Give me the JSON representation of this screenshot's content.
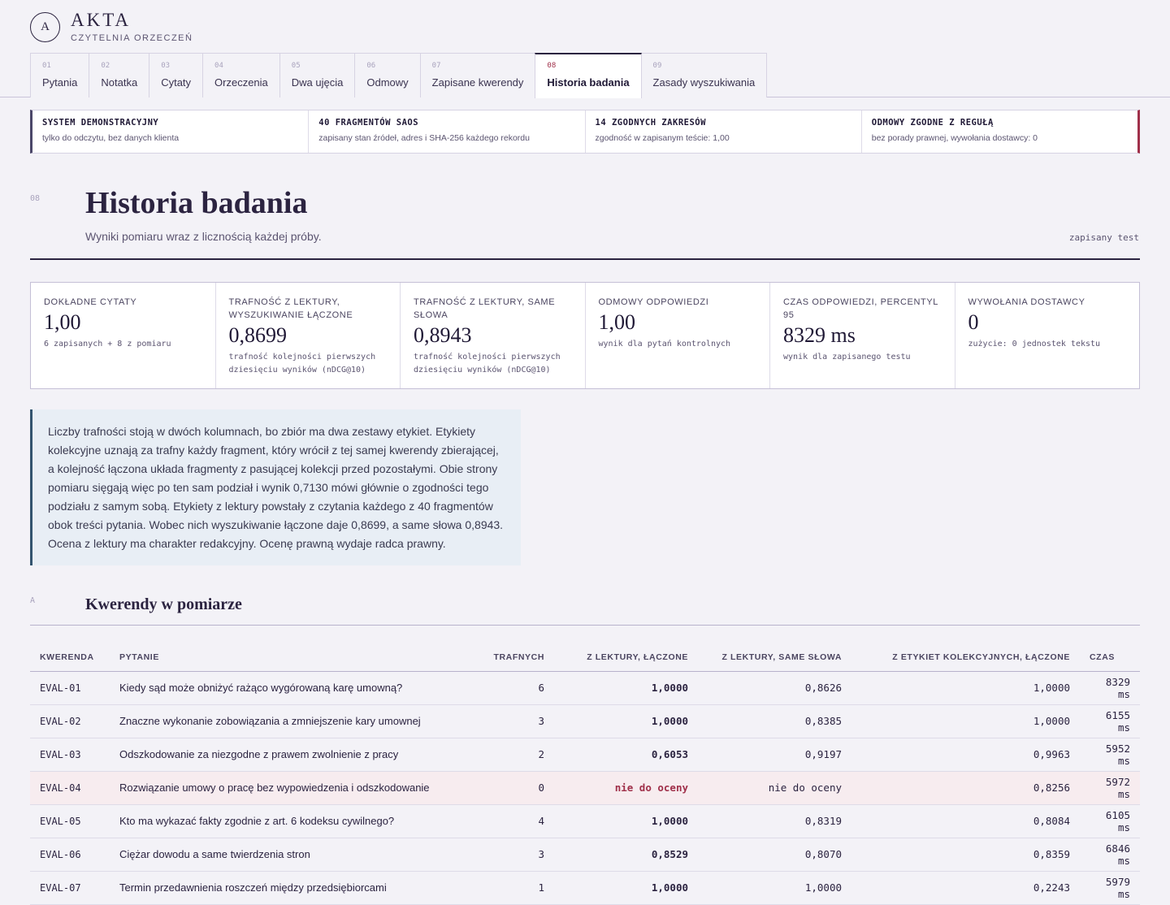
{
  "brand": {
    "logo_letter": "A",
    "title": "AKTA",
    "subtitle": "CZYTELNIA ORZECZEŃ"
  },
  "tabs": [
    {
      "num": "01",
      "label": "Pytania"
    },
    {
      "num": "02",
      "label": "Notatka"
    },
    {
      "num": "03",
      "label": "Cytaty"
    },
    {
      "num": "04",
      "label": "Orzeczenia"
    },
    {
      "num": "05",
      "label": "Dwa ujęcia"
    },
    {
      "num": "06",
      "label": "Odmowy"
    },
    {
      "num": "07",
      "label": "Zapisane kwerendy"
    },
    {
      "num": "08",
      "label": "Historia badania",
      "active": true
    },
    {
      "num": "09",
      "label": "Zasady wyszukiwania"
    }
  ],
  "status": [
    {
      "title": "SYSTEM DEMONSTRACYJNY",
      "desc": "tylko do odczytu, bez danych klienta"
    },
    {
      "title": "40 FRAGMENTÓW SAOS",
      "desc": "zapisany stan źródeł, adres i SHA-256 każdego rekordu"
    },
    {
      "title": "14 ZGODNYCH ZAKRESÓW",
      "desc": "zgodność w zapisanym teście: 1,00"
    },
    {
      "title": "ODMOWY ZGODNE Z REGUŁĄ",
      "desc": "bez porady prawnej, wywołania dostawcy: 0"
    }
  ],
  "section": {
    "num": "08",
    "title": "Historia badania",
    "subtitle": "Wyniki pomiaru wraz z licznością każdej próby.",
    "tag": "zapisany test"
  },
  "metrics": [
    {
      "key": "DOKŁADNE CYTATY",
      "value": "1,00",
      "sub": "6 zapisanych + 8 z pomiaru"
    },
    {
      "key": "TRAFNOŚĆ Z LEKTURY, WYSZUKIWANIE ŁĄCZONE",
      "value": "0,8699",
      "sub": "trafność kolejności pierwszych dziesięciu wyników (nDCG@10)"
    },
    {
      "key": "TRAFNOŚĆ Z LEKTURY, SAME SŁOWA",
      "value": "0,8943",
      "sub": "trafność kolejności pierwszych dziesięciu wyników (nDCG@10)"
    },
    {
      "key": "ODMOWY ODPOWIEDZI",
      "value": "1,00",
      "sub": "wynik dla pytań kontrolnych"
    },
    {
      "key": "CZAS ODPOWIEDZI, PERCENTYL 95",
      "value": "8329 ms",
      "sub": "wynik dla zapisanego testu"
    },
    {
      "key": "WYWOŁANIA DOSTAWCY",
      "value": "0",
      "sub": "zużycie: 0 jednostek tekstu"
    }
  ],
  "note": "Liczby trafności stoją w dwóch kolumnach, bo zbiór ma dwa zestawy etykiet. Etykiety kolekcyjne uznają za trafny każdy fragment, który wrócił z tej samej kwerendy zbierającej, a kolejność łączona układa fragmenty z pasującej kolekcji przed pozostałymi. Obie strony pomiaru sięgają więc po ten sam podział i wynik 0,7130 mówi głównie o zgodności tego podziału z samym sobą. Etykiety z lektury powstały z czytania każdego z 40 fragmentów obok treści pytania. Wobec nich wyszukiwanie łączone daje 0,8699, a same słowa 0,8943. Ocena z lektury ma charakter redakcyjny. Ocenę prawną wydaje radca prawny.",
  "queries": {
    "num": "A",
    "title": "Kwerendy w pomiarze",
    "headers": [
      "KWERENDA",
      "PYTANIE",
      "TRAFNYCH",
      "Z LEKTURY, ŁĄCZONE",
      "Z LEKTURY, SAME SŁOWA",
      "Z ETYKIET KOLEKCYJNYCH, ŁĄCZONE",
      "CZAS"
    ],
    "rows": [
      {
        "id": "EVAL-01",
        "q": "Kiedy sąd może obniżyć rażąco wygórowaną karę umowną?",
        "n": "6",
        "a": "1,0000",
        "b": "0,8626",
        "c": "1,0000",
        "t": "8329 ms"
      },
      {
        "id": "EVAL-02",
        "q": "Znaczne wykonanie zobowiązania a zmniejszenie kary umownej",
        "n": "3",
        "a": "1,0000",
        "b": "0,8385",
        "c": "1,0000",
        "t": "6155 ms"
      },
      {
        "id": "EVAL-03",
        "q": "Odszkodowanie za niezgodne z prawem zwolnienie z pracy",
        "n": "2",
        "a": "0,6053",
        "b": "0,9197",
        "c": "0,9963",
        "t": "5952 ms"
      },
      {
        "id": "EVAL-04",
        "q": "Rozwiązanie umowy o pracę bez wypowiedzenia i odszkodowanie",
        "n": "0",
        "a": "nie do oceny",
        "b": "nie do oceny",
        "c": "0,8256",
        "t": "5972 ms",
        "na": true
      },
      {
        "id": "EVAL-05",
        "q": "Kto ma wykazać fakty zgodnie z art. 6 kodeksu cywilnego?",
        "n": "4",
        "a": "1,0000",
        "b": "0,8319",
        "c": "0,8084",
        "t": "6105 ms"
      },
      {
        "id": "EVAL-06",
        "q": "Ciężar dowodu a same twierdzenia stron",
        "n": "3",
        "a": "0,8529",
        "b": "0,8070",
        "c": "0,8359",
        "t": "6846 ms"
      },
      {
        "id": "EVAL-07",
        "q": "Termin przedawnienia roszczeń między przedsiębiorcami",
        "n": "1",
        "a": "1,0000",
        "b": "1,0000",
        "c": "0,2243",
        "t": "5979 ms"
      }
    ]
  }
}
